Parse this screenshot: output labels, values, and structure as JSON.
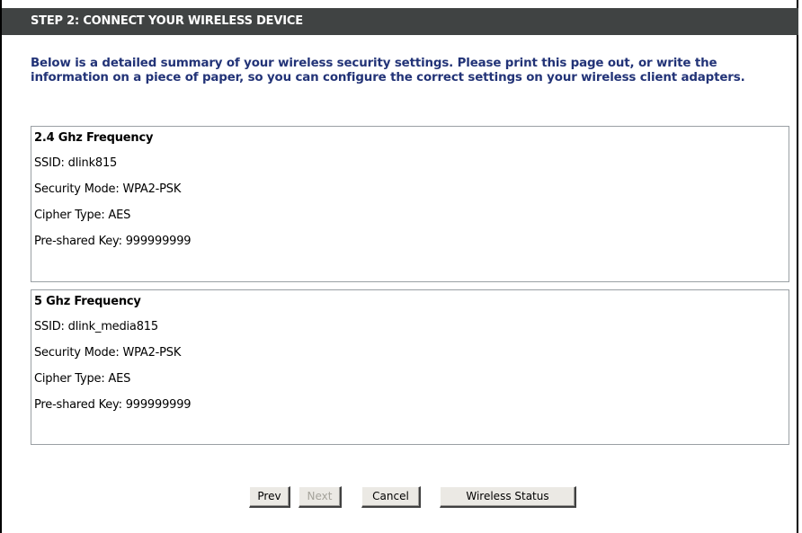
{
  "header": {
    "title": "STEP 2: CONNECT YOUR WIRELESS DEVICE"
  },
  "intro": {
    "text": "Below is a detailed summary of your wireless security settings. Please print this page out, or write the information on a piece of paper, so you can configure the correct settings on your wireless client adapters."
  },
  "bands": [
    {
      "title": "2.4 Ghz Frequency",
      "ssid": "SSID: dlink815",
      "security_mode": "Security Mode: WPA2-PSK",
      "cipher_type": "Cipher Type: AES",
      "psk": "Pre-shared Key: 999999999"
    },
    {
      "title": "5 Ghz Frequency",
      "ssid": "SSID: dlink_media815",
      "security_mode": "Security Mode: WPA2-PSK",
      "cipher_type": "Cipher Type: AES",
      "psk": "Pre-shared Key: 999999999"
    }
  ],
  "buttons": {
    "prev": "Prev",
    "next": "Next",
    "cancel": "Cancel",
    "wireless_status": "Wireless Status"
  },
  "colors": {
    "title_bar": "#404343",
    "intro_text": "#223377",
    "box_border": "#9aa0a4",
    "button_face": "#ebe9e4",
    "disabled_text": "#a5a39b"
  }
}
